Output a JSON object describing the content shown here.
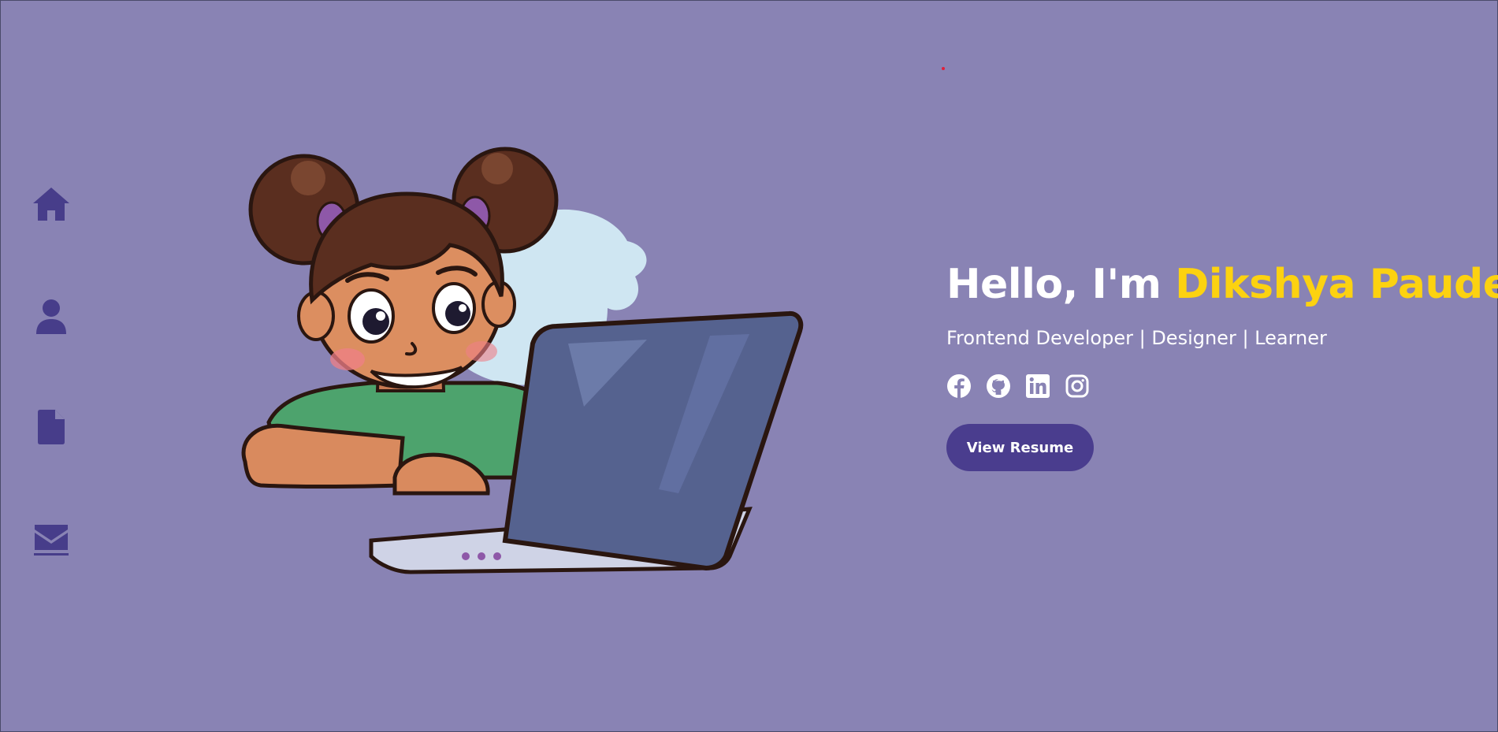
{
  "colors": {
    "background": "#8983b4",
    "nav_icon": "#473d8a",
    "accent_name": "#fcd210",
    "button_bg": "#4a3d8e",
    "text": "#ffffff"
  },
  "sidenav": {
    "items": [
      {
        "icon": "home-icon"
      },
      {
        "icon": "user-icon"
      },
      {
        "icon": "file-icon"
      },
      {
        "icon": "envelope-icon"
      }
    ]
  },
  "hero": {
    "greeting": "Hello, I'm ",
    "name": "Dikshya Paudel",
    "subtitle": "Frontend Developer | Designer | Learner",
    "socials": [
      {
        "icon": "facebook-icon"
      },
      {
        "icon": "github-icon"
      },
      {
        "icon": "linkedin-icon"
      },
      {
        "icon": "instagram-icon"
      }
    ],
    "resume_button": "View Resume"
  }
}
